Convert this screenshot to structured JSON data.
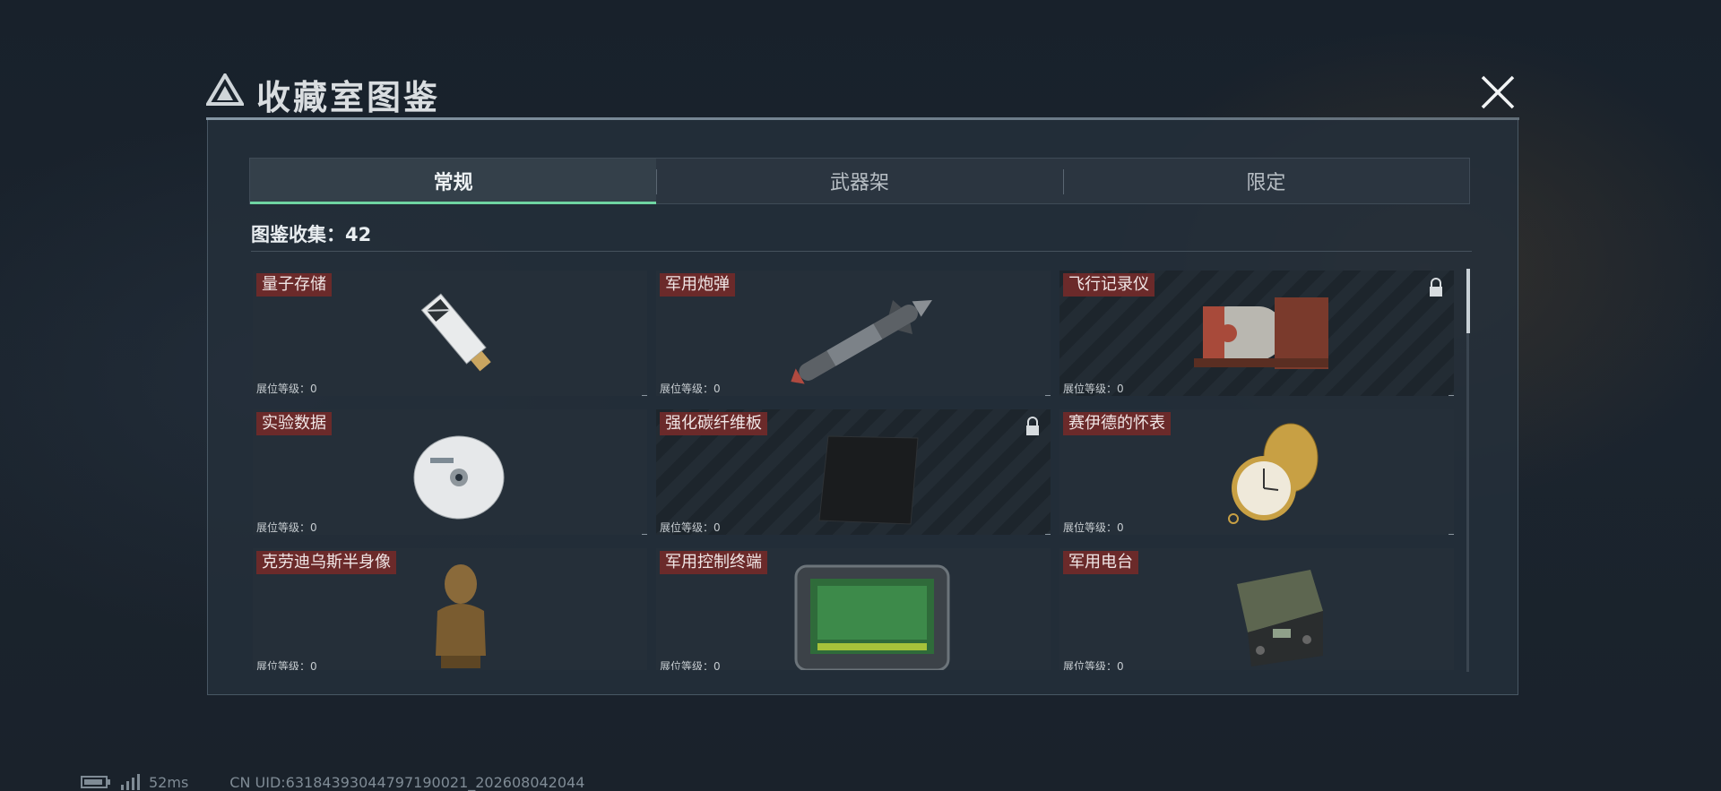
{
  "header": {
    "title": "收藏室图鉴"
  },
  "tabs": [
    {
      "label": "常规",
      "active": true
    },
    {
      "label": "武器架",
      "active": false
    },
    {
      "label": "限定",
      "active": false
    }
  ],
  "collection": {
    "text": "图鉴收集：42",
    "count": 42
  },
  "items": [
    {
      "name": "量子存储",
      "level": "展位等级：0",
      "locked": false,
      "icon": "usb-drive-icon"
    },
    {
      "name": "军用炮弹",
      "level": "展位等级：0",
      "locked": false,
      "icon": "artillery-shell-icon"
    },
    {
      "name": "飞行记录仪",
      "level": "展位等级：0",
      "locked": true,
      "icon": "flight-recorder-icon"
    },
    {
      "name": "实验数据",
      "level": "展位等级：0",
      "locked": false,
      "icon": "data-disc-icon"
    },
    {
      "name": "强化碳纤维板",
      "level": "展位等级：0",
      "locked": true,
      "icon": "carbon-plate-icon"
    },
    {
      "name": "赛伊德的怀表",
      "level": "展位等级：0",
      "locked": false,
      "icon": "pocket-watch-icon"
    },
    {
      "name": "克劳迪乌斯半身像",
      "level": "展位等级：0",
      "locked": false,
      "icon": "bust-statue-icon"
    },
    {
      "name": "军用控制终端",
      "level": "展位等级：0",
      "locked": false,
      "icon": "control-terminal-icon"
    },
    {
      "name": "军用电台",
      "level": "展位等级：0",
      "locked": false,
      "icon": "military-radio-icon"
    }
  ],
  "status": {
    "ping": "52ms",
    "uid": "CN UID:63184393044797190021_202608042044"
  },
  "colors": {
    "accent": "#6fd4a2",
    "tag": "#6b2a2a",
    "panel": "#242f3a"
  }
}
